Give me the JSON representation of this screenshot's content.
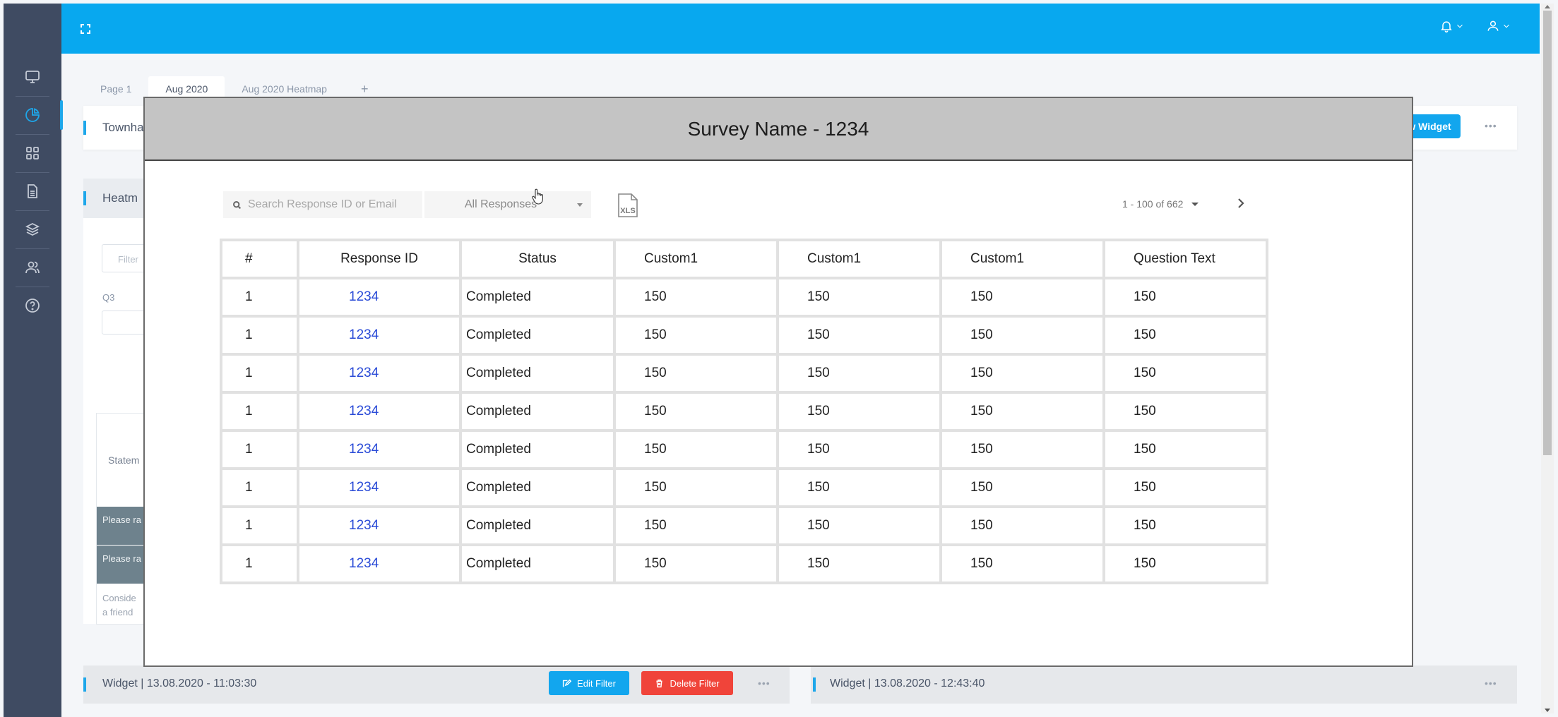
{
  "sidebar": {
    "items": [
      {
        "icon": "monitor-icon",
        "active": false
      },
      {
        "icon": "pie-chart-icon",
        "active": true
      },
      {
        "icon": "grid-icon",
        "active": false
      },
      {
        "icon": "document-icon",
        "active": false
      },
      {
        "icon": "layers-icon",
        "active": false
      },
      {
        "icon": "users-icon",
        "active": false
      },
      {
        "icon": "help-icon",
        "active": false
      }
    ]
  },
  "topbar": {
    "expand_icon": "expand-icon",
    "notifications_icon": "bell-icon",
    "user_icon": "user-icon"
  },
  "tabs": [
    {
      "label": "Page 1",
      "active": false
    },
    {
      "label": "Aug 2020",
      "active": true
    },
    {
      "label": "Aug 2020 Heatmap",
      "active": false
    },
    {
      "label": "+",
      "active": false
    }
  ],
  "background": {
    "townhall_title": "Townha",
    "add_widget_label": "w Widget",
    "more_label": "•••",
    "heatmap_title": "Heatm",
    "filter_placeholder": "Filter",
    "q3_label": "Q3",
    "statement_label": "Statem",
    "statement_rows": [
      "Please ra",
      "Please ra"
    ],
    "consider_line1": "Conside",
    "consider_line2": "a friend",
    "widgets": [
      {
        "title": "Widget | 13.08.2020 - 11:03:30",
        "edit_label": "Edit Filter",
        "delete_label": "Delete Filter"
      },
      {
        "title": "Widget | 13.08.2020 - 12:43:40"
      }
    ]
  },
  "modal": {
    "title": "Survey Name - 1234",
    "search_placeholder": "Search Response ID or Email",
    "filter_selected": "All Responses",
    "export_label": "XLS",
    "pagination": "1 - 100 of 662",
    "table": {
      "columns": [
        "#",
        "Response ID",
        "Status",
        "Custom1",
        "Custom1",
        "Custom1",
        "Question Text"
      ],
      "rows": [
        [
          "1",
          "1234",
          "Completed",
          "150",
          "150",
          "150",
          "150"
        ],
        [
          "1",
          "1234",
          "Completed",
          "150",
          "150",
          "150",
          "150"
        ],
        [
          "1",
          "1234",
          "Completed",
          "150",
          "150",
          "150",
          "150"
        ],
        [
          "1",
          "1234",
          "Completed",
          "150",
          "150",
          "150",
          "150"
        ],
        [
          "1",
          "1234",
          "Completed",
          "150",
          "150",
          "150",
          "150"
        ],
        [
          "1",
          "1234",
          "Completed",
          "150",
          "150",
          "150",
          "150"
        ],
        [
          "1",
          "1234",
          "Completed",
          "150",
          "150",
          "150",
          "150"
        ],
        [
          "1",
          "1234",
          "Completed",
          "150",
          "150",
          "150",
          "150"
        ]
      ]
    }
  },
  "colors": {
    "topbar": "#08a8ef",
    "sidebar": "#3f4b62",
    "accent": "#1ea7ea",
    "delete": "#f0443a",
    "link": "#2a4bd7",
    "modal_header": "#c4c4c4"
  }
}
